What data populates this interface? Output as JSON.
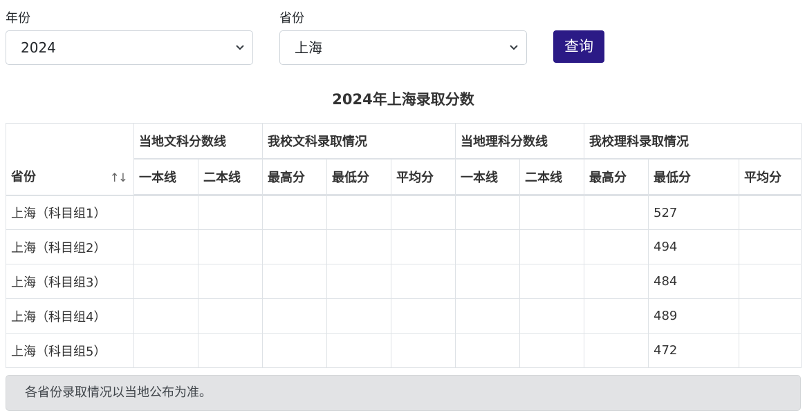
{
  "filters": {
    "year_label": "年份",
    "year_value": "2024",
    "province_label": "省份",
    "province_value": "上海",
    "query_button": "查询"
  },
  "table": {
    "title": "2024年上海录取分数",
    "province_header": "省份",
    "sort_icon": "↑↓",
    "groups": [
      "当地文科分数线",
      "我校文科录取情况",
      "当地理科分数线",
      "我校理科录取情况"
    ],
    "subheaders": [
      "一本线",
      "二本线",
      "最高分",
      "最低分",
      "平均分",
      "一本线",
      "二本线",
      "最高分",
      "最低分",
      "平均分"
    ],
    "rows": [
      {
        "province": "上海（科目组1）",
        "cells": [
          "",
          "",
          "",
          "",
          "",
          "",
          "",
          "",
          "527",
          ""
        ]
      },
      {
        "province": "上海（科目组2）",
        "cells": [
          "",
          "",
          "",
          "",
          "",
          "",
          "",
          "",
          "494",
          ""
        ]
      },
      {
        "province": "上海（科目组3）",
        "cells": [
          "",
          "",
          "",
          "",
          "",
          "",
          "",
          "",
          "484",
          ""
        ]
      },
      {
        "province": "上海（科目组4）",
        "cells": [
          "",
          "",
          "",
          "",
          "",
          "",
          "",
          "",
          "489",
          ""
        ]
      },
      {
        "province": "上海（科目组5）",
        "cells": [
          "",
          "",
          "",
          "",
          "",
          "",
          "",
          "",
          "472",
          ""
        ]
      }
    ]
  },
  "note": "各省份录取情况以当地公布为准。",
  "colors": {
    "button": "#2b1a86",
    "note_bg": "#e2e3e5"
  }
}
